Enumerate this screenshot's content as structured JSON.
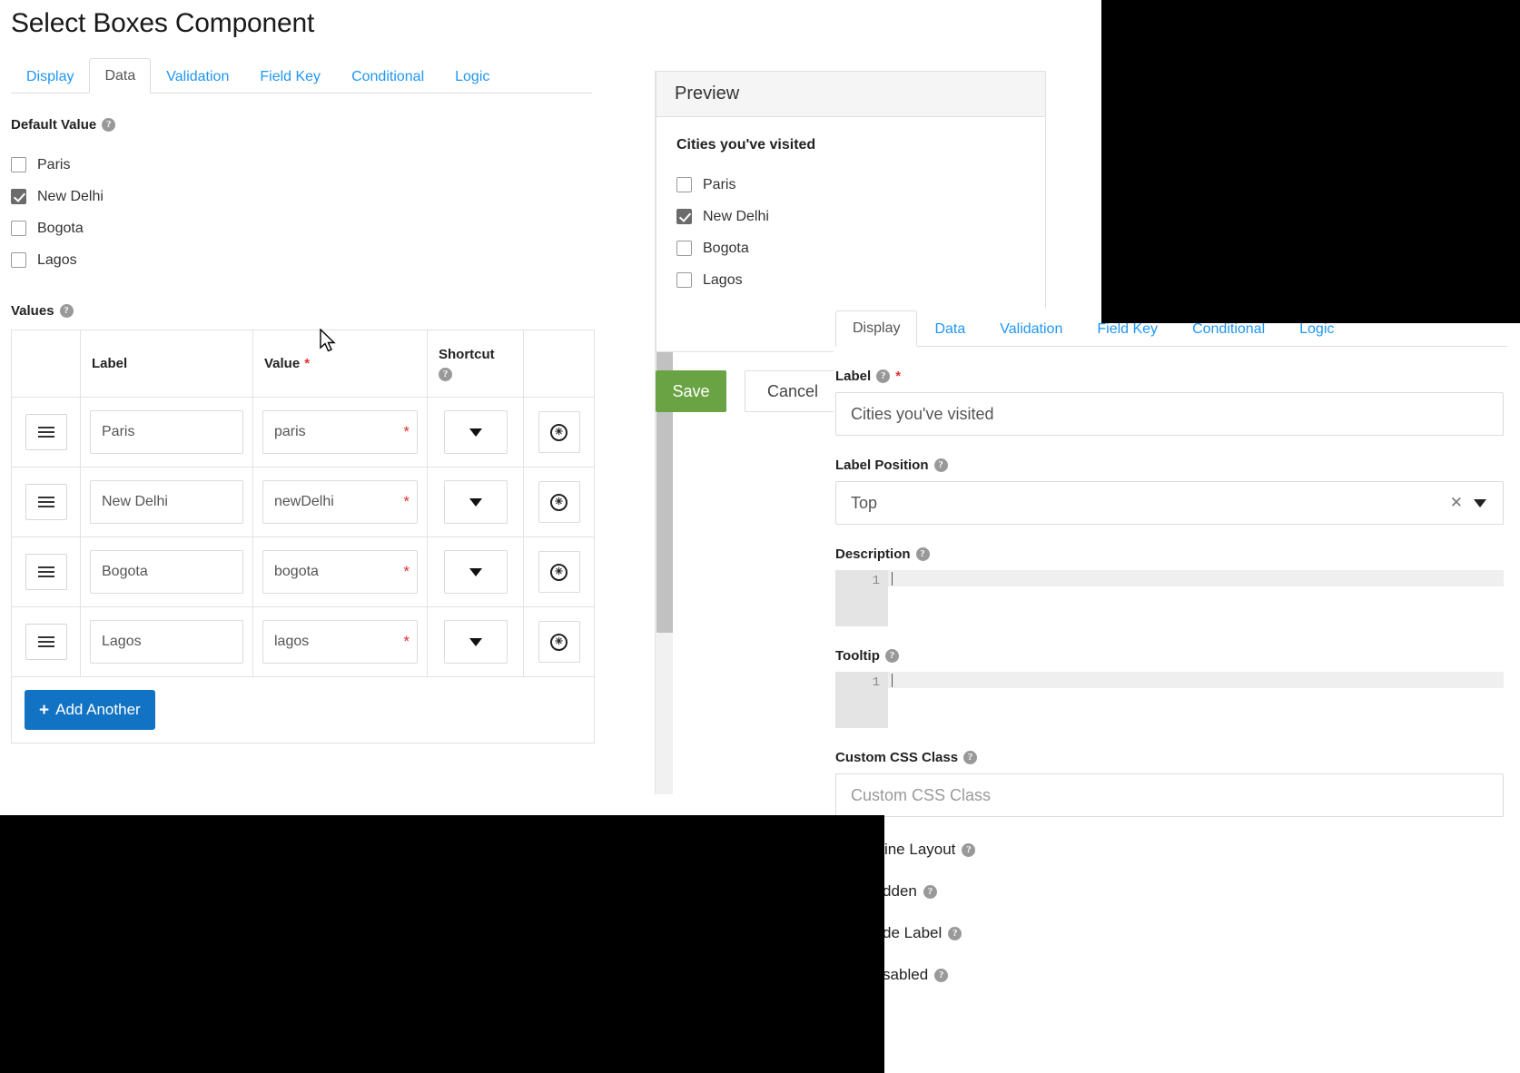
{
  "page": {
    "title": "Select Boxes Component"
  },
  "left_tabs": [
    {
      "label": "Display",
      "active": false
    },
    {
      "label": "Data",
      "active": true
    },
    {
      "label": "Validation",
      "active": false
    },
    {
      "label": "Field Key",
      "active": false
    },
    {
      "label": "Conditional",
      "active": false
    },
    {
      "label": "Logic",
      "active": false
    }
  ],
  "default_value": {
    "label": "Default Value",
    "help_icon": "question-mark-icon",
    "options": [
      {
        "label": "Paris",
        "checked": false
      },
      {
        "label": "New Delhi",
        "checked": true
      },
      {
        "label": "Bogota",
        "checked": false
      },
      {
        "label": "Lagos",
        "checked": false
      }
    ]
  },
  "values": {
    "label": "Values",
    "help_icon": "question-mark-icon",
    "columns": [
      "",
      "Label",
      "Value",
      "Shortcut",
      ""
    ],
    "value_required_marker": "*",
    "rows": [
      {
        "drag_icon": "drag-handle-icon",
        "label": "Paris",
        "value": "paris",
        "required_marker": "*",
        "shortcut": "",
        "delete_icon": "remove-circle-icon"
      },
      {
        "drag_icon": "drag-handle-icon",
        "label": "New Delhi",
        "value": "newDelhi",
        "required_marker": "*",
        "shortcut": "",
        "delete_icon": "remove-circle-icon"
      },
      {
        "drag_icon": "drag-handle-icon",
        "label": "Bogota",
        "value": "bogota",
        "required_marker": "*",
        "shortcut": "",
        "delete_icon": "remove-circle-icon"
      },
      {
        "drag_icon": "drag-handle-icon",
        "label": "Lagos",
        "value": "lagos",
        "required_marker": "*",
        "shortcut": "",
        "delete_icon": "remove-circle-icon"
      }
    ],
    "add_another_label": "Add Another",
    "add_another_plus": "+"
  },
  "preview": {
    "header": "Preview",
    "field_label": "Cities you've visited",
    "options": [
      {
        "label": "Paris",
        "checked": false
      },
      {
        "label": "New Delhi",
        "checked": true
      },
      {
        "label": "Bogota",
        "checked": false
      },
      {
        "label": "Lagos",
        "checked": false
      }
    ]
  },
  "actions": {
    "save": "Save",
    "cancel": "Cancel",
    "save_color": "#6aa343"
  },
  "right_tabs": [
    {
      "label": "Display",
      "active": true
    },
    {
      "label": "Data",
      "active": false
    },
    {
      "label": "Validation",
      "active": false
    },
    {
      "label": "Field Key",
      "active": false
    },
    {
      "label": "Conditional",
      "active": false
    },
    {
      "label": "Logic",
      "active": false
    }
  ],
  "settings": {
    "label_field": {
      "label": "Label",
      "required_marker": "*",
      "value": "Cities you've visited",
      "help_icon": "question-mark-icon"
    },
    "label_position": {
      "label": "Label Position",
      "value": "Top",
      "clear_icon": "close-x-icon",
      "caret_icon": "chevron-down-icon",
      "help_icon": "question-mark-icon"
    },
    "description": {
      "label": "Description",
      "line_number": "1",
      "value": "",
      "help_icon": "question-mark-icon"
    },
    "tooltip": {
      "label": "Tooltip",
      "line_number": "1",
      "value": "",
      "help_icon": "question-mark-icon"
    },
    "custom_css_class": {
      "label": "Custom CSS Class",
      "placeholder": "Custom CSS Class",
      "value": "",
      "help_icon": "question-mark-icon"
    },
    "toggles": [
      {
        "label": "Inline Layout",
        "checked": false
      },
      {
        "label": "Hidden",
        "checked": false
      },
      {
        "label": "Hide Label",
        "checked": false
      },
      {
        "label": "Disabled",
        "checked": false
      }
    ]
  },
  "scrollbar": {
    "up_arrow_icon": "caret-up-icon"
  },
  "colors": {
    "accent": "#2196f3",
    "add_button": "#1273c4",
    "required": "#e03131"
  }
}
